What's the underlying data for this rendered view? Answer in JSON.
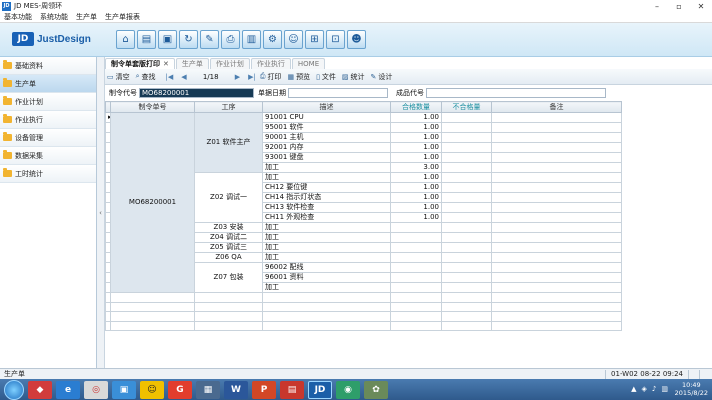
{
  "window": {
    "title": "JD MES-周领环",
    "icon_text": "JD"
  },
  "menu": [
    "基本功能",
    "系统功能",
    "生产单",
    "生产单报表"
  ],
  "logo": {
    "mark": "JD",
    "text": "JustDesign"
  },
  "toolbar_icons": [
    "home-icon",
    "save-icon",
    "monitor-icon",
    "refresh-icon",
    "edit-icon",
    "print-icon",
    "book-icon",
    "gear-icon",
    "user-icon",
    "network-icon",
    "network-alt-icon",
    "people-icon"
  ],
  "sidebar": {
    "items": [
      {
        "label": "基础资料",
        "active": false
      },
      {
        "label": "生产单",
        "active": true
      },
      {
        "label": "作业计划",
        "active": false
      },
      {
        "label": "作业执行",
        "active": false
      },
      {
        "label": "设备管理",
        "active": false
      },
      {
        "label": "数据采集",
        "active": false
      },
      {
        "label": "工时统计",
        "active": false
      }
    ]
  },
  "tabs": [
    {
      "label": "制令单套版打印",
      "active": true,
      "closable": true
    },
    {
      "label": "生产单",
      "active": false
    },
    {
      "label": "作业计划",
      "active": false
    },
    {
      "label": "作业执行",
      "active": false
    },
    {
      "label": "HOME",
      "active": false
    }
  ],
  "subtoolbar": {
    "clear": "清空",
    "query": "查找",
    "page": "1/18",
    "print": "打印",
    "preview": "预览",
    "file": "文件",
    "stats": "统计",
    "design": "设计"
  },
  "filters": {
    "order_label": "制令代号",
    "order_value": "MO68200001",
    "date_label": "单据日期",
    "date_value": "",
    "product_label": "成品代号",
    "product_value": ""
  },
  "grid": {
    "headers": [
      "制令单号",
      "工序",
      "描述",
      "合格数量",
      "不合格量",
      "备注"
    ],
    "order_no": "MO68200001",
    "groups": [
      {
        "process": "Z01 软件主产",
        "rows": [
          {
            "desc": "91001 CPU",
            "qty": "1.00"
          },
          {
            "desc": "95001 软件",
            "qty": "1.00"
          },
          {
            "desc": "90001 主机",
            "qty": "1.00"
          },
          {
            "desc": "92001 内存",
            "qty": "1.00"
          },
          {
            "desc": "93001 键盘",
            "qty": "1.00"
          },
          {
            "desc": "加工",
            "qty": "3.00"
          }
        ]
      },
      {
        "process": "Z02 调试一",
        "rows": [
          {
            "desc": "加工",
            "qty": "1.00"
          },
          {
            "desc": "CH12 要位键",
            "qty": "1.00"
          },
          {
            "desc": "CH14 指示灯状态",
            "qty": "1.00"
          },
          {
            "desc": "CH13 软件检查",
            "qty": "1.00"
          },
          {
            "desc": "CH11 外观检查",
            "qty": "1.00"
          }
        ]
      },
      {
        "process": "Z03 安装",
        "rows": [
          {
            "desc": "加工",
            "qty": ""
          }
        ]
      },
      {
        "process": "Z04 调试二",
        "rows": [
          {
            "desc": "加工",
            "qty": ""
          }
        ]
      },
      {
        "process": "Z05 调试三",
        "rows": [
          {
            "desc": "加工",
            "qty": ""
          }
        ]
      },
      {
        "process": "Z06 QA",
        "rows": [
          {
            "desc": "加工",
            "qty": ""
          }
        ]
      },
      {
        "process": "Z07 包装",
        "rows": [
          {
            "desc": "96002 配线",
            "qty": ""
          },
          {
            "desc": "96001 资料",
            "qty": ""
          },
          {
            "desc": "加工",
            "qty": ""
          }
        ]
      }
    ],
    "blank_rows": 4
  },
  "status": {
    "left": "生产单",
    "user": "01-W02",
    "date": "08-22 09:24"
  },
  "taskbar": {
    "time": "10:49",
    "date": "2015/8/22"
  }
}
